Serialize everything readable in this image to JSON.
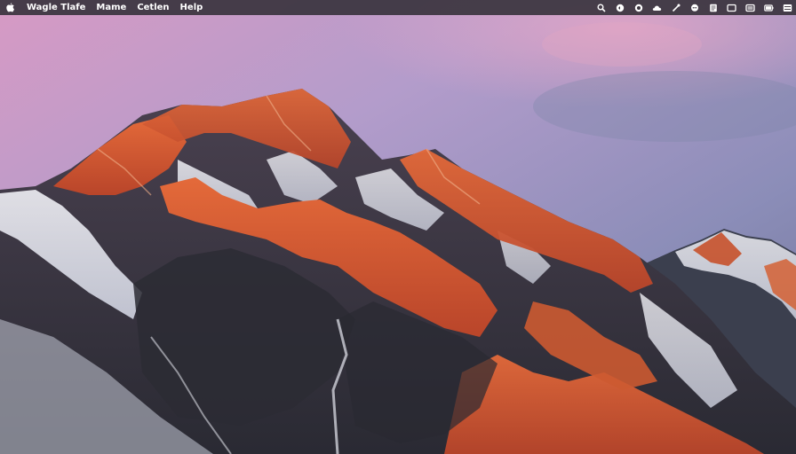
{
  "menubar": {
    "apple_icon": "apple-logo-icon",
    "items": [
      {
        "label": "Wagle Tlafe"
      },
      {
        "label": "Mame"
      },
      {
        "label": "Cetlen"
      },
      {
        "label": "Help"
      }
    ],
    "status_icons": [
      "search-icon",
      "control-circle-icon",
      "timer-icon",
      "cloud-icon",
      "tools-icon",
      "chat-icon",
      "notes-icon",
      "window-icon",
      "display-icon",
      "battery-icon",
      "control-center-icon"
    ]
  },
  "wallpaper": {
    "subject": "mountain-range-sunset",
    "colors": {
      "sky_pink": "#d79ac4",
      "sky_lavender": "#9d98c6",
      "sky_slate": "#6e7290",
      "rock_orange": "#d9582c",
      "rock_dark": "#3a3540",
      "snow": "#e6e6ee"
    }
  }
}
